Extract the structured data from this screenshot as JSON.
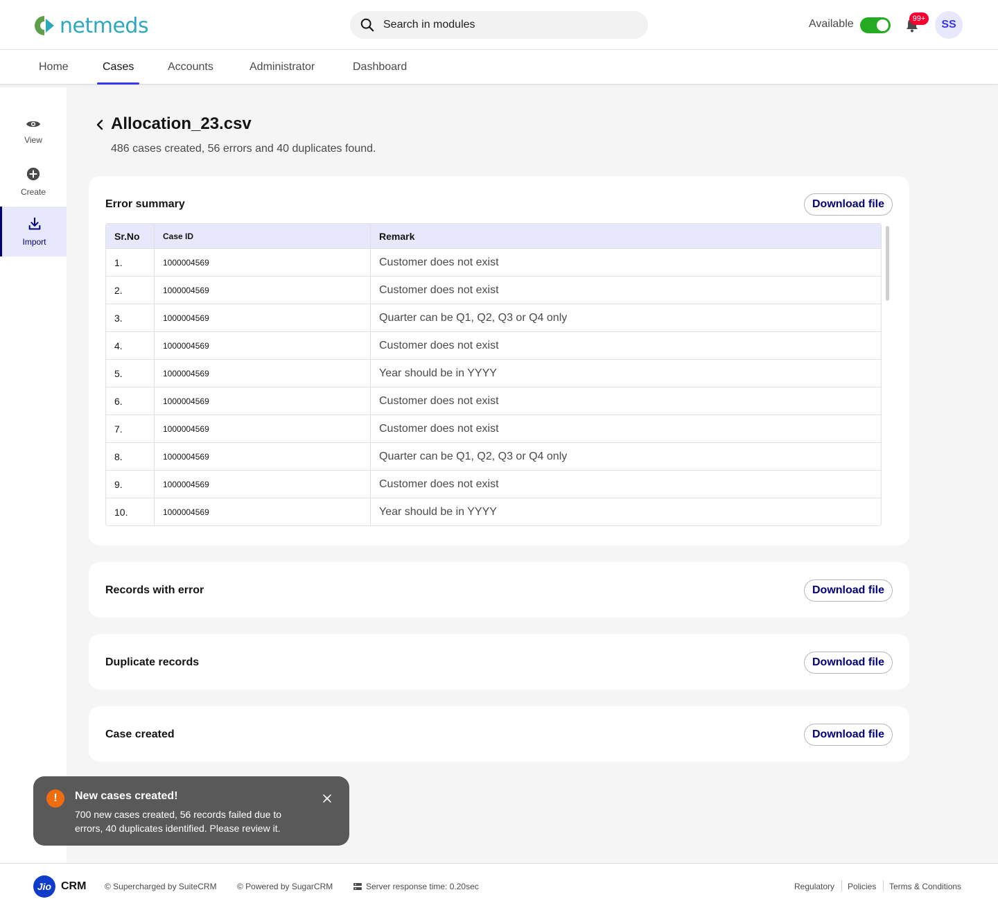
{
  "header": {
    "logo_text": "netmeds",
    "search_placeholder": "Search in modules",
    "availability_label": "Available",
    "notification_count": "99+",
    "avatar_initials": "SS",
    "accent_color": "#3535f3",
    "toggle_color": "#25ab21"
  },
  "nav": {
    "tabs": [
      {
        "label": "Home",
        "active": false
      },
      {
        "label": "Cases",
        "active": true
      },
      {
        "label": "Accounts",
        "active": false
      },
      {
        "label": "Administrator",
        "active": false
      },
      {
        "label": "Dashboard",
        "active": false
      }
    ]
  },
  "sidebar": {
    "items": [
      {
        "label": "View",
        "icon": "eye-icon",
        "active": false
      },
      {
        "label": "Create",
        "icon": "plus-circle-icon",
        "active": false
      },
      {
        "label": "Import",
        "icon": "download-icon",
        "active": true
      }
    ]
  },
  "page": {
    "title": "Allocation_23.csv",
    "subtitle": "486 cases created, 56 errors and 40 duplicates found."
  },
  "error_summary": {
    "title": "Error summary",
    "download_label": "Download file",
    "columns": [
      "Sr.No",
      "Case ID",
      "Remark"
    ],
    "rows": [
      {
        "sr": "1.",
        "case_id": "1000004569",
        "remark": "Customer does not exist"
      },
      {
        "sr": "2.",
        "case_id": "1000004569",
        "remark": "Customer does not exist"
      },
      {
        "sr": "3.",
        "case_id": "1000004569",
        "remark": "Quarter can be Q1, Q2, Q3 or Q4 only"
      },
      {
        "sr": "4.",
        "case_id": "1000004569",
        "remark": "Customer does not exist"
      },
      {
        "sr": "5.",
        "case_id": "1000004569",
        "remark": "Year should be in YYYY"
      },
      {
        "sr": "6.",
        "case_id": "1000004569",
        "remark": "Customer does not exist"
      },
      {
        "sr": "7.",
        "case_id": "1000004569",
        "remark": "Customer does not exist"
      },
      {
        "sr": "8.",
        "case_id": "1000004569",
        "remark": "Quarter can be Q1, Q2, Q3 or Q4 only"
      },
      {
        "sr": "9.",
        "case_id": "1000004569",
        "remark": "Customer does not exist"
      },
      {
        "sr": "10.",
        "case_id": "1000004569",
        "remark": "Year should be in YYYY"
      }
    ]
  },
  "sections": [
    {
      "title": "Records with error",
      "download_label": "Download file"
    },
    {
      "title": "Duplicate records",
      "download_label": "Download file"
    },
    {
      "title": "Case created",
      "download_label": "Download file"
    }
  ],
  "toast": {
    "title": "New cases created!",
    "message": "700 new cases created, 56 records failed due to errors, 40 duplicates identified. Please review it.",
    "icon_glyph": "!"
  },
  "footer": {
    "brand": "Jio",
    "product": "CRM",
    "supercharged": "© Supercharged by SuiteCRM",
    "powered": "© Powered by SugarCRM",
    "server_response": "Server response time: 0.20sec",
    "links": [
      "Regulatory",
      "Policies",
      "Terms & Conditions"
    ]
  }
}
